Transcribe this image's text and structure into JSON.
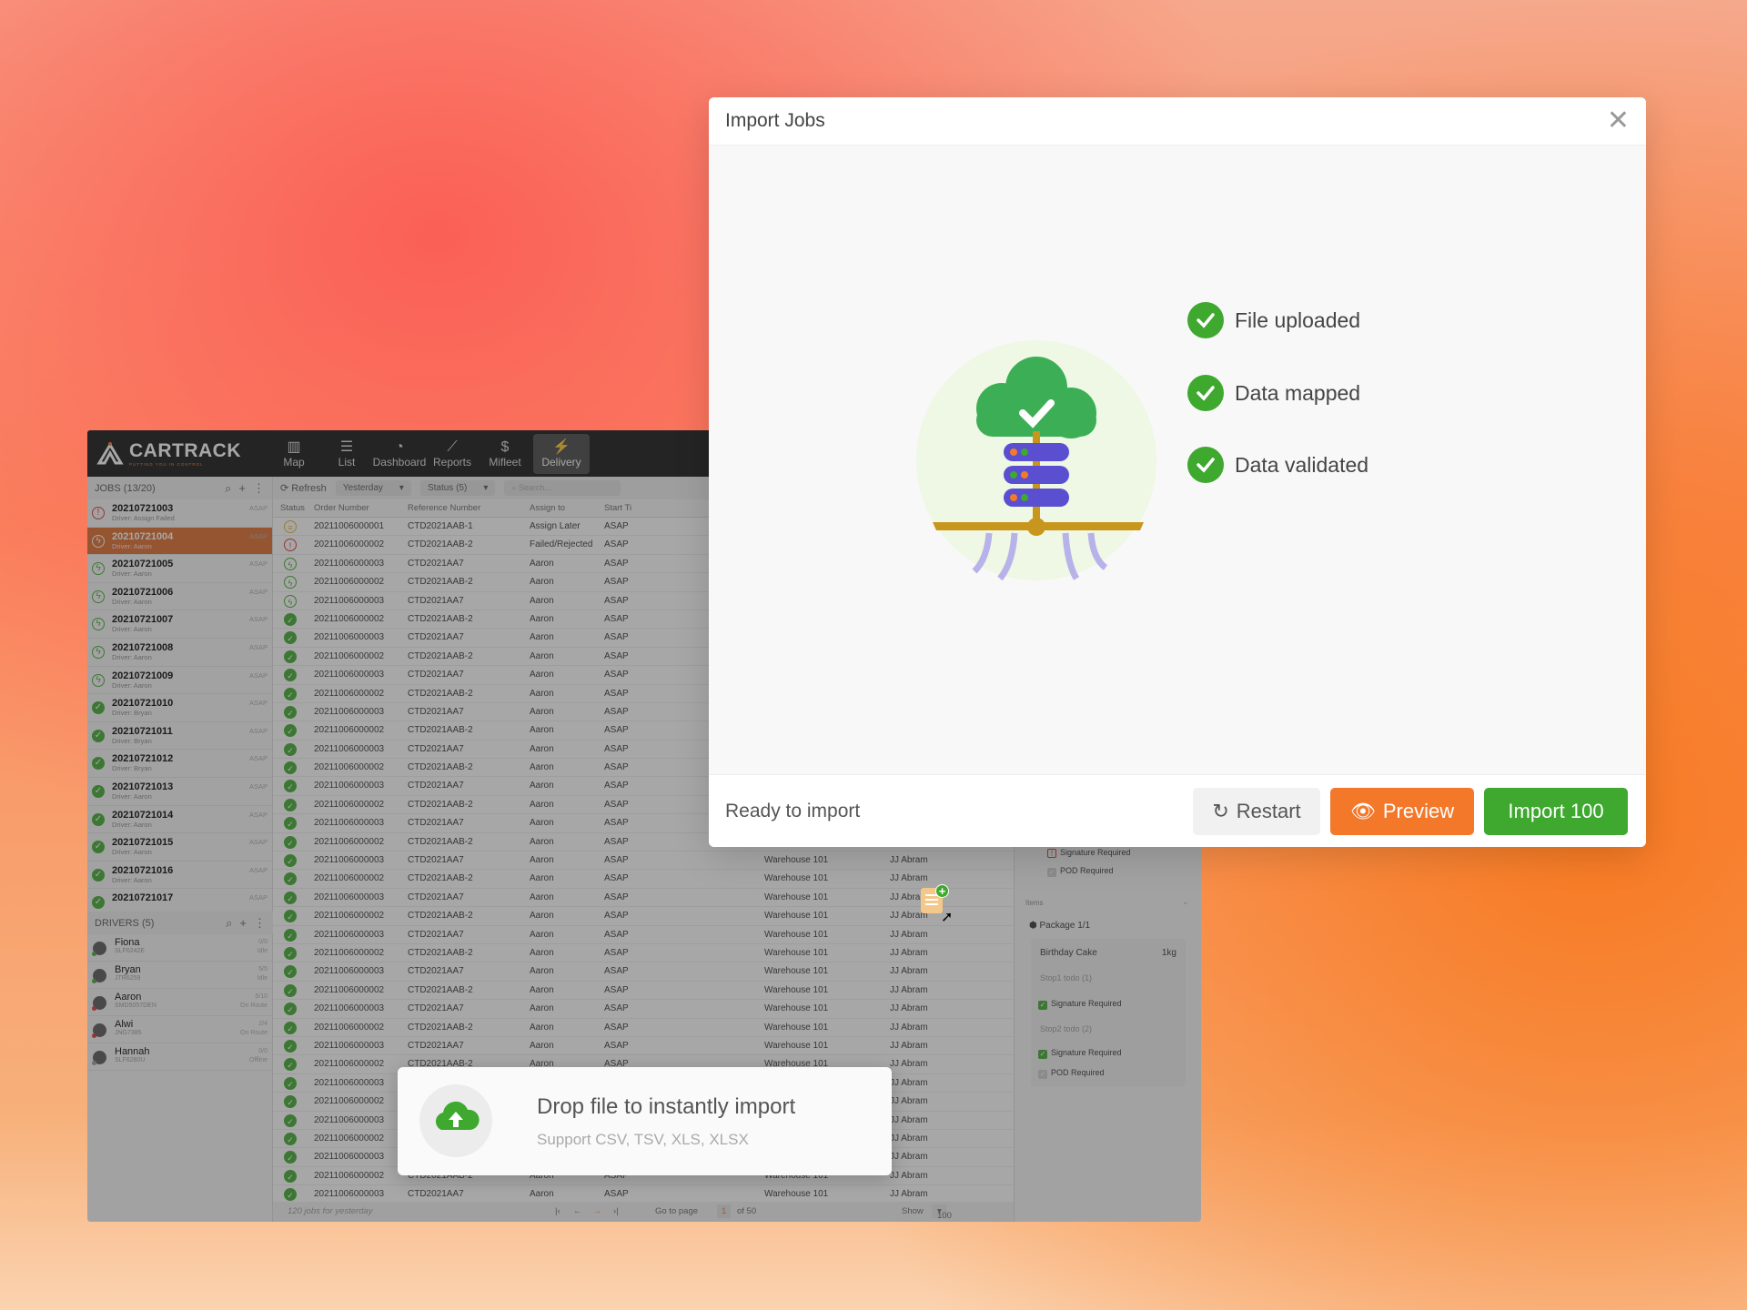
{
  "app": {
    "logo": "CARTRACK",
    "tagline": "PUTTING YOU IN CONTROL",
    "nav": [
      {
        "label": "Map",
        "icon": "map-icon"
      },
      {
        "label": "List",
        "icon": "list-icon"
      },
      {
        "label": "Dashboard",
        "icon": "dashboard-icon"
      },
      {
        "label": "Reports",
        "icon": "chart-icon"
      },
      {
        "label": "Mifleet",
        "icon": "dollar-icon"
      },
      {
        "label": "Delivery",
        "icon": "lightning-icon",
        "active": true
      }
    ],
    "jobs_header": "JOBS (13/20)",
    "jobs": [
      {
        "id": "20210721003",
        "driver": "Driver: Assign Failed",
        "time": "ASAP",
        "status": "failed"
      },
      {
        "id": "20210721004",
        "driver": "Driver: Aaron",
        "time": "ASAP",
        "status": "in-progress",
        "selected": true
      },
      {
        "id": "20210721005",
        "driver": "Driver: Aaron",
        "time": "ASAP",
        "status": "in-progress"
      },
      {
        "id": "20210721006",
        "driver": "Driver: Aaron",
        "time": "ASAP",
        "status": "in-progress"
      },
      {
        "id": "20210721007",
        "driver": "Driver: Aaron",
        "time": "ASAP",
        "status": "in-progress"
      },
      {
        "id": "20210721008",
        "driver": "Driver: Aaron",
        "time": "ASAP",
        "status": "in-progress"
      },
      {
        "id": "20210721009",
        "driver": "Driver: Aaron",
        "time": "ASAP",
        "status": "in-progress"
      },
      {
        "id": "20210721010",
        "driver": "Driver: Bryan",
        "time": "ASAP",
        "status": "completed"
      },
      {
        "id": "20210721011",
        "driver": "Driver: Bryan",
        "time": "ASAP",
        "status": "completed"
      },
      {
        "id": "20210721012",
        "driver": "Driver: Bryan",
        "time": "ASAP",
        "status": "completed"
      },
      {
        "id": "20210721013",
        "driver": "Driver: Aaron",
        "time": "ASAP",
        "status": "completed"
      },
      {
        "id": "20210721014",
        "driver": "Driver: Aaron",
        "time": "ASAP",
        "status": "completed"
      },
      {
        "id": "20210721015",
        "driver": "Driver: Aaron",
        "time": "ASAP",
        "status": "completed"
      },
      {
        "id": "20210721016",
        "driver": "Driver: Aaron",
        "time": "ASAP",
        "status": "completed"
      },
      {
        "id": "20210721017",
        "driver": "",
        "time": "ASAP",
        "status": "completed"
      }
    ],
    "drivers_header": "DRIVERS (5)",
    "drivers": [
      {
        "name": "Fiona",
        "plate": "SLF6242E",
        "count": "0/0",
        "state": "Idle",
        "dot": "#3ea82f"
      },
      {
        "name": "Bryan",
        "plate": "JTR6259",
        "count": "5/5",
        "state": "Idle",
        "dot": "#3ea82f"
      },
      {
        "name": "Aaron",
        "plate": "SMD5057DEN",
        "count": "5/10",
        "state": "On Route",
        "dot": "#d9302f"
      },
      {
        "name": "Alwi",
        "plate": "JNG7385",
        "count": "2/4",
        "state": "On Route",
        "dot": "#d9302f"
      },
      {
        "name": "Hannah",
        "plate": "SLF6280U",
        "count": "0/0",
        "state": "Offline",
        "dot": "#999"
      }
    ],
    "toolbar": {
      "refresh": "Refresh",
      "date": "Yesterday",
      "status": "Status (5)",
      "search_placeholder": "Search..."
    },
    "columns": [
      "Status",
      "Order Number",
      "Reference Number",
      "Assign to",
      "Start Ti"
    ],
    "rows": [
      [
        "pending",
        "20211006000001",
        "CTD2021AAB-1",
        "Assign Later",
        "ASAP",
        "",
        ""
      ],
      [
        "failed",
        "20211006000002",
        "CTD2021AAB-2",
        "Failed/Rejected",
        "ASAP",
        "",
        ""
      ],
      [
        "in-progress",
        "20211006000003",
        "CTD2021AA7",
        "Aaron",
        "ASAP",
        "",
        ""
      ],
      [
        "in-progress",
        "20211006000002",
        "CTD2021AAB-2",
        "Aaron",
        "ASAP",
        "",
        ""
      ],
      [
        "in-progress",
        "20211006000003",
        "CTD2021AA7",
        "Aaron",
        "ASAP",
        "",
        ""
      ],
      [
        "completed",
        "20211006000002",
        "CTD2021AAB-2",
        "Aaron",
        "ASAP",
        "",
        ""
      ],
      [
        "completed",
        "20211006000003",
        "CTD2021AA7",
        "Aaron",
        "ASAP",
        "",
        ""
      ],
      [
        "completed",
        "20211006000002",
        "CTD2021AAB-2",
        "Aaron",
        "ASAP",
        "",
        ""
      ],
      [
        "completed",
        "20211006000003",
        "CTD2021AA7",
        "Aaron",
        "ASAP",
        "",
        ""
      ],
      [
        "completed",
        "20211006000002",
        "CTD2021AAB-2",
        "Aaron",
        "ASAP",
        "",
        ""
      ],
      [
        "completed",
        "20211006000003",
        "CTD2021AA7",
        "Aaron",
        "ASAP",
        "",
        ""
      ],
      [
        "completed",
        "20211006000002",
        "CTD2021AAB-2",
        "Aaron",
        "ASAP",
        "",
        ""
      ],
      [
        "completed",
        "20211006000003",
        "CTD2021AA7",
        "Aaron",
        "ASAP",
        "",
        ""
      ],
      [
        "completed",
        "20211006000002",
        "CTD2021AAB-2",
        "Aaron",
        "ASAP",
        "",
        ""
      ],
      [
        "completed",
        "20211006000003",
        "CTD2021AA7",
        "Aaron",
        "ASAP",
        "",
        ""
      ],
      [
        "completed",
        "20211006000002",
        "CTD2021AAB-2",
        "Aaron",
        "ASAP",
        "",
        ""
      ],
      [
        "completed",
        "20211006000003",
        "CTD2021AA7",
        "Aaron",
        "ASAP",
        "",
        ""
      ],
      [
        "completed",
        "20211006000002",
        "CTD2021AAB-2",
        "Aaron",
        "ASAP",
        "",
        ""
      ],
      [
        "completed",
        "20211006000003",
        "CTD2021AA7",
        "Aaron",
        "ASAP",
        "Warehouse 101",
        "JJ Abram"
      ],
      [
        "completed",
        "20211006000002",
        "CTD2021AAB-2",
        "Aaron",
        "ASAP",
        "Warehouse 101",
        "JJ Abram"
      ],
      [
        "completed",
        "20211006000003",
        "CTD2021AA7",
        "Aaron",
        "ASAP",
        "Warehouse 101",
        "JJ Abram"
      ],
      [
        "completed",
        "20211006000002",
        "CTD2021AAB-2",
        "Aaron",
        "ASAP",
        "Warehouse 101",
        "JJ Abram"
      ],
      [
        "completed",
        "20211006000003",
        "CTD2021AA7",
        "Aaron",
        "ASAP",
        "Warehouse 101",
        "JJ Abram"
      ],
      [
        "completed",
        "20211006000002",
        "CTD2021AAB-2",
        "Aaron",
        "ASAP",
        "Warehouse 101",
        "JJ Abram"
      ],
      [
        "completed",
        "20211006000003",
        "CTD2021AA7",
        "Aaron",
        "ASAP",
        "Warehouse 101",
        "JJ Abram"
      ],
      [
        "completed",
        "20211006000002",
        "CTD2021AAB-2",
        "Aaron",
        "ASAP",
        "Warehouse 101",
        "JJ Abram"
      ],
      [
        "completed",
        "20211006000003",
        "CTD2021AA7",
        "Aaron",
        "ASAP",
        "Warehouse 101",
        "JJ Abram"
      ],
      [
        "completed",
        "20211006000002",
        "CTD2021AAB-2",
        "Aaron",
        "ASAP",
        "Warehouse 101",
        "JJ Abram"
      ],
      [
        "completed",
        "20211006000003",
        "CTD2021AA7",
        "Aaron",
        "ASAP",
        "Warehouse 101",
        "JJ Abram"
      ],
      [
        "completed",
        "20211006000002",
        "CTD2021AAB-2",
        "Aaron",
        "ASAP",
        "Warehouse 101",
        "JJ Abram"
      ],
      [
        "completed",
        "20211006000003",
        "CTD2021AA7",
        "Aaron",
        "ASAP",
        "Warehouse 101",
        "JJ Abram"
      ],
      [
        "completed",
        "20211006000002",
        "CTD2021AAB-2",
        "Aaron",
        "ASAP",
        "Warehouse 101",
        "JJ Abram"
      ],
      [
        "completed",
        "20211006000003",
        "CTD2021AA7",
        "Aaron",
        "ASAP",
        "Warehouse 101",
        "JJ Abram"
      ],
      [
        "completed",
        "20211006000002",
        "CTD2021AAB-2",
        "Aaron",
        "ASAP",
        "Warehouse 101",
        "JJ Abram"
      ],
      [
        "completed",
        "20211006000003",
        "CTD2021AA7",
        "Aaron",
        "ASAP",
        "Warehouse 101",
        "JJ Abram"
      ],
      [
        "completed",
        "20211006000002",
        "CTD2021AAB-2",
        "Aaron",
        "ASAP",
        "Warehouse 101",
        "JJ Abram"
      ],
      [
        "completed",
        "20211006000003",
        "CTD2021AA7",
        "Aaron",
        "ASAP",
        "Warehouse 101",
        "JJ Abram"
      ]
    ],
    "footer": {
      "summary": "120 jobs for yesterday",
      "goto": "Go to page",
      "page": "1",
      "of": "of 50",
      "show": "Show",
      "rows": "100 rows"
    },
    "detail": {
      "sig1": "Signature Required",
      "pod1": "POD Required",
      "items": "Items",
      "package": "Package 1/1",
      "item_name": "Birthday Cake",
      "item_weight": "1kg",
      "stop1": "Stop1 todo (1)",
      "sig2": "Signature Required",
      "stop2": "Stop2 todo (2)",
      "sig3": "Signature Required",
      "pod3": "POD Required"
    }
  },
  "toast": {
    "title": "Drop file to instantly import",
    "subtitle": "Support CSV, TSV, XLS, XLSX"
  },
  "modal": {
    "title": "Import Jobs",
    "steps": [
      "File uploaded",
      "Data mapped",
      "Data validated"
    ],
    "status": "Ready to import",
    "restart": "Restart",
    "preview": "Preview",
    "import": "Import 100"
  },
  "colors": {
    "accent": "#f4782a",
    "success": "#3ea82f",
    "failed": "#d9302f",
    "pending": "#e0b030"
  }
}
